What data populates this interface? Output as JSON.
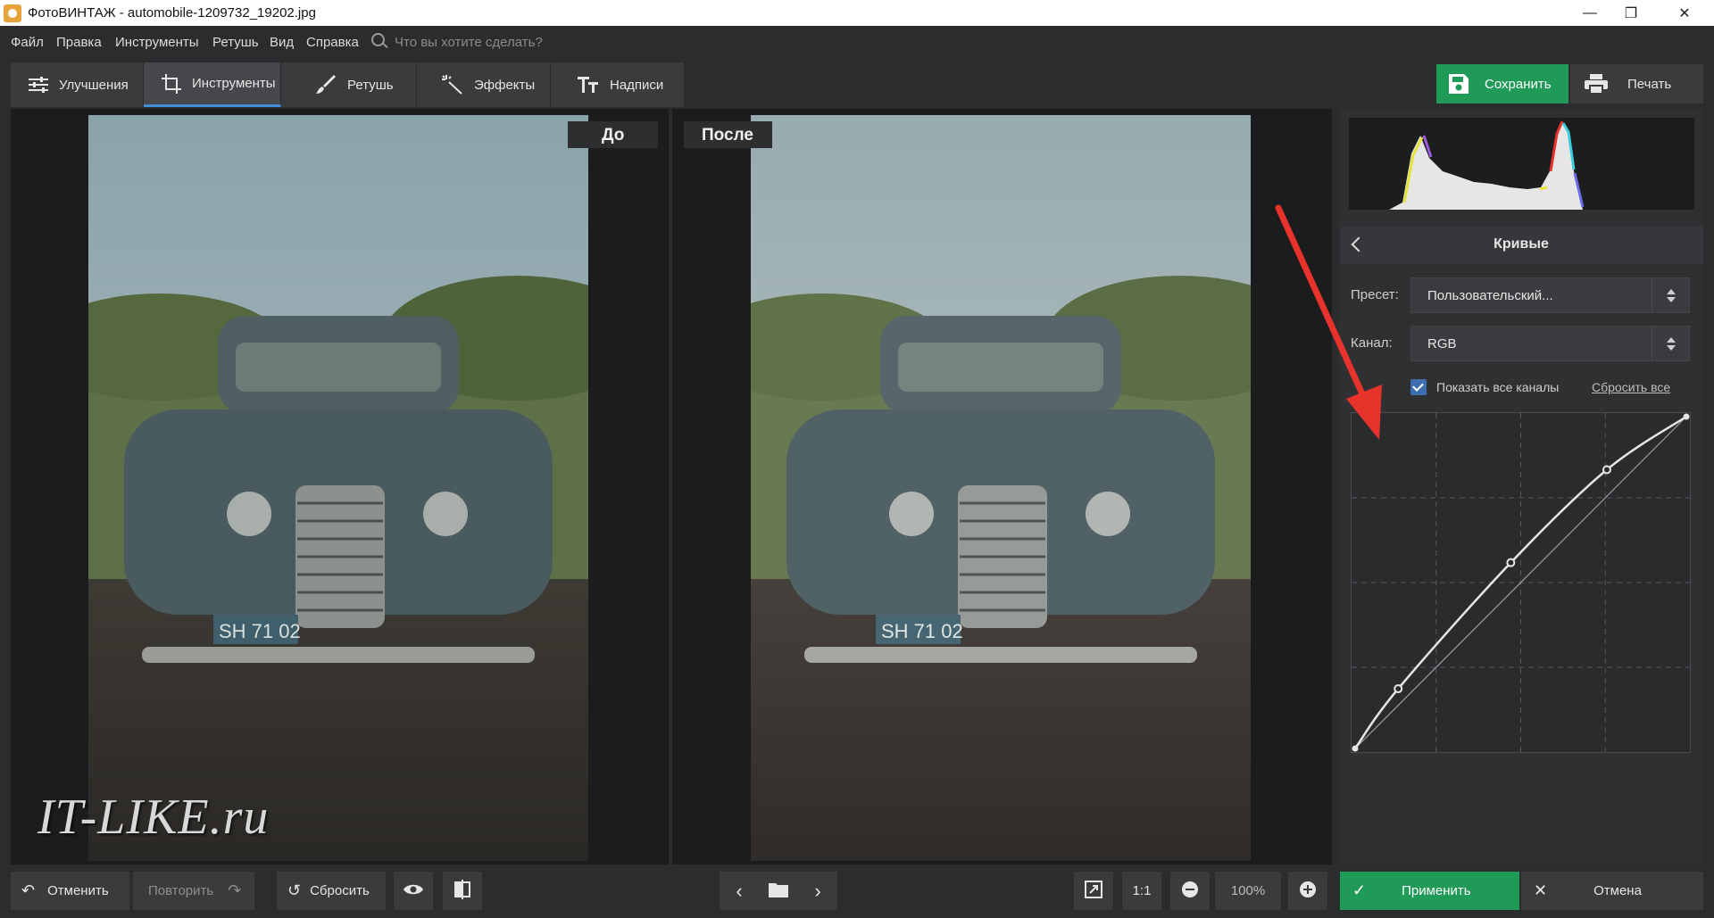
{
  "window": {
    "title": "ФотоВИНТАЖ - automobile-1209732_19202.jpg",
    "minimize_icon": "minimize-icon",
    "maximize_icon": "restore-icon",
    "close_icon": "close-icon"
  },
  "menu": {
    "items": [
      "Файл",
      "Правка",
      "Инструменты",
      "Ретушь",
      "Вид",
      "Справка"
    ],
    "search_placeholder": "Что вы хотите сделать?"
  },
  "tabs": [
    {
      "label": "Улучшения",
      "icon": "sliders-icon"
    },
    {
      "label": "Инструменты",
      "icon": "crop-icon",
      "active": true
    },
    {
      "label": "Ретушь",
      "icon": "brush-icon"
    },
    {
      "label": "Эффекты",
      "icon": "magic-wand-icon"
    },
    {
      "label": "Надписи",
      "icon": "text-icon"
    }
  ],
  "toolbar": {
    "save_label": "Сохранить",
    "print_label": "Печать"
  },
  "preview": {
    "before_label": "До",
    "after_label": "После",
    "watermark": "IT-LIKE.ru",
    "plate_text": "SH 71 02"
  },
  "curves": {
    "title": "Кривые",
    "preset_label": "Пресет:",
    "preset_value": "Пользовательский...",
    "channel_label": "Канал:",
    "channel_value": "RGB",
    "show_all_channels_label": "Показать все каналы",
    "show_all_channels_checked": true,
    "reset_all_label": "Сбросить все",
    "control_points": [
      {
        "in": 0,
        "out": 0
      },
      {
        "in": 13,
        "out": 18
      },
      {
        "in": 47,
        "out": 56
      },
      {
        "in": 76,
        "out": 84
      },
      {
        "in": 100,
        "out": 100
      }
    ]
  },
  "bottom": {
    "undo_label": "Отменить",
    "redo_label": "Повторить",
    "reset_label": "Сбросить",
    "zoom_one_label": "1:1",
    "zoom_value": "100%",
    "apply_label": "Применить",
    "cancel_label": "Отмена"
  },
  "colors": {
    "accent_green": "#1f9a57",
    "active_tab_underline": "#3d8fd8",
    "checkbox_blue": "#3d6fb0",
    "annotation_red": "#e8322c"
  }
}
